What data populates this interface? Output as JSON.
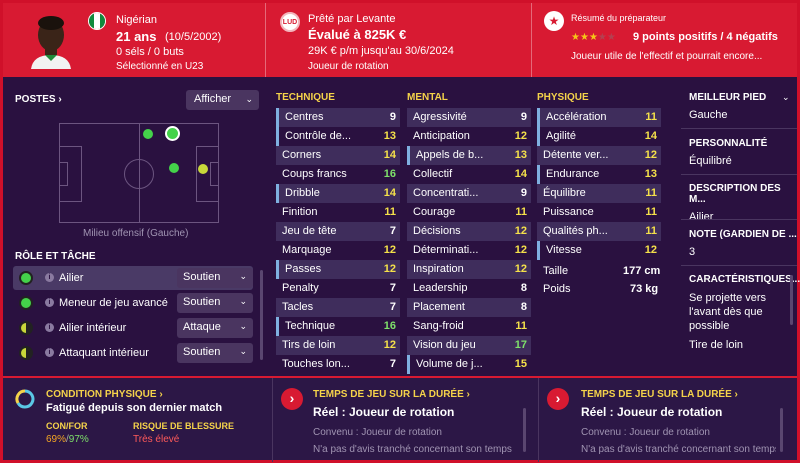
{
  "header": {
    "nationality": "Nigérian",
    "age": "21 ans",
    "birthdate": "(10/5/2002)",
    "caps": "0 séls / 0 buts",
    "selected": "Sélectionné en U23",
    "loan": "Prêté par Levante",
    "club_badge": "LUD",
    "value": "Évalué à 825K €",
    "wage": "29K € p/m jusqu'au 30/6/2024",
    "role": "Joueur de rotation",
    "report_title": "Résumé du préparateur",
    "stars": 3,
    "stars_max": 5,
    "points": "9 points positifs / 4 négatifs",
    "report_summary": "Joueur utile de l'effectif et pourrait encore..."
  },
  "positions": {
    "title": "POSTES",
    "show_button": "Afficher",
    "position_label": "Milieu offensif (Gauche)"
  },
  "roles": {
    "title": "RÔLE ET TÂCHE",
    "items": [
      {
        "name": "Ailier",
        "duty": "Soutien",
        "color": "#44d24a"
      },
      {
        "name": "Meneur de jeu avancé",
        "duty": "Soutien",
        "color": "#44d24a"
      },
      {
        "name": "Ailier intérieur",
        "duty": "Attaque",
        "color": "#c8d83a"
      },
      {
        "name": "Attaquant intérieur",
        "duty": "Soutien",
        "color": "#c8d83a"
      }
    ]
  },
  "technique": {
    "title": "TECHNIQUE",
    "items": [
      {
        "n": "Centres",
        "v": "9"
      },
      {
        "n": "Contrôle de...",
        "v": "13"
      },
      {
        "n": "Corners",
        "v": "14"
      },
      {
        "n": "Coups francs",
        "v": "16"
      },
      {
        "n": "Dribble",
        "v": "14"
      },
      {
        "n": "Finition",
        "v": "11"
      },
      {
        "n": "Jeu de tête",
        "v": "7"
      },
      {
        "n": "Marquage",
        "v": "12"
      },
      {
        "n": "Passes",
        "v": "12"
      },
      {
        "n": "Penalty",
        "v": "7"
      },
      {
        "n": "Tacles",
        "v": "7"
      },
      {
        "n": "Technique",
        "v": "16"
      },
      {
        "n": "Tirs de loin",
        "v": "12"
      },
      {
        "n": "Touches lon...",
        "v": "7"
      }
    ]
  },
  "mental": {
    "title": "MENTAL",
    "items": [
      {
        "n": "Agressivité",
        "v": "9"
      },
      {
        "n": "Anticipation",
        "v": "12"
      },
      {
        "n": "Appels de b...",
        "v": "13"
      },
      {
        "n": "Collectif",
        "v": "14"
      },
      {
        "n": "Concentrati...",
        "v": "9"
      },
      {
        "n": "Courage",
        "v": "11"
      },
      {
        "n": "Décisions",
        "v": "12"
      },
      {
        "n": "Déterminati...",
        "v": "12"
      },
      {
        "n": "Inspiration",
        "v": "12"
      },
      {
        "n": "Leadership",
        "v": "8"
      },
      {
        "n": "Placement",
        "v": "8"
      },
      {
        "n": "Sang-froid",
        "v": "11"
      },
      {
        "n": "Vision du jeu",
        "v": "17"
      },
      {
        "n": "Volume de j...",
        "v": "15"
      }
    ]
  },
  "physique": {
    "title": "PHYSIQUE",
    "items": [
      {
        "n": "Accélération",
        "v": "11"
      },
      {
        "n": "Agilité",
        "v": "14"
      },
      {
        "n": "Détente ver...",
        "v": "12"
      },
      {
        "n": "Endurance",
        "v": "13"
      },
      {
        "n": "Équilibre",
        "v": "11"
      },
      {
        "n": "Puissance",
        "v": "11"
      },
      {
        "n": "Qualités ph...",
        "v": "11"
      },
      {
        "n": "Vitesse",
        "v": "12"
      }
    ],
    "height_label": "Taille",
    "height": "177 cm",
    "weight_label": "Poids",
    "weight": "73 kg"
  },
  "side": {
    "foot_label": "MEILLEUR PIED",
    "foot": "Gauche",
    "pers_label": "PERSONNALITÉ",
    "pers": "Équilibré",
    "desc_label": "DESCRIPTION DES M...",
    "desc": "Ailier",
    "note_label": "NOTE (GARDIEN DE ...",
    "note": "3",
    "traits_label": "CARACTÉRISTIQUES...",
    "trait1": "Se projette vers l'avant dès que possible",
    "trait2": "Tire de loin"
  },
  "bottom": {
    "cond_title": "CONDITION PHYSIQUE",
    "cond_text": "Fatigué depuis son dernier match",
    "con_label": "CON/FOR",
    "con": "69%",
    "for": "97%",
    "risk_label": "RISQUE DE BLESSURE",
    "risk": "Très élevé",
    "pt1_title": "TEMPS DE JEU SUR LA DURÉE",
    "pt1_val": "Réel : Joueur de rotation",
    "pt1_label": "Convenu : Joueur de rotation",
    "pt1_note": "N'a pas d'avis tranché concernant son temps",
    "pt2_title": "TEMPS DE JEU SUR LA DURÉE",
    "pt2_val": "Réel : Joueur de rotation",
    "pt2_label": "Convenu : Joueur de rotation",
    "pt2_note": "N'a pas d'avis tranché concernant son temps"
  }
}
